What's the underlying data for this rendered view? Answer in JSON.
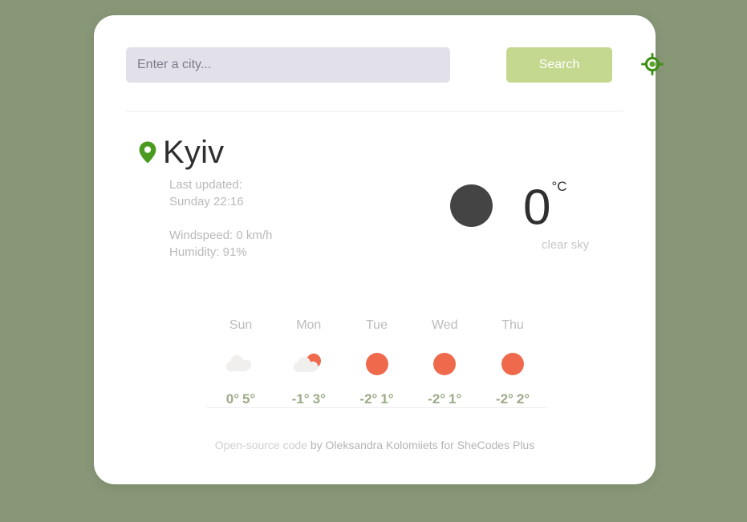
{
  "theme": {
    "page_background": "#889877",
    "card_background": "#ffffff",
    "accent_green": "#c5d890",
    "icon_green": "#4a9a20",
    "sun_orange": "#ef6a4c",
    "cloud_gray": "#f0efed",
    "forecast_temp_color": "#9cab88",
    "night_circle": "#444444"
  },
  "search": {
    "placeholder": "Enter a city...",
    "value": "",
    "button_label": "Search",
    "geolocation_icon": "gps-target-icon"
  },
  "current": {
    "location_icon": "map-pin-icon",
    "city": "Kyiv",
    "last_updated_label": "Last updated:",
    "last_updated_value": "Sunday 22:16",
    "windspeed": "Windspeed: 0 km/h",
    "humidity": "Humidity: 91%",
    "icon": "clear-sky-night-icon",
    "temperature": "0",
    "unit": "°C",
    "description": "clear sky"
  },
  "forecast": [
    {
      "day": "Sun",
      "icon": "cloud-icon",
      "temp_max": "0°",
      "temp_min": "5°"
    },
    {
      "day": "Mon",
      "icon": "sun-behind-cloud-icon",
      "temp_max": "-1°",
      "temp_min": "3°"
    },
    {
      "day": "Tue",
      "icon": "sun-icon",
      "temp_max": "-2°",
      "temp_min": "1°"
    },
    {
      "day": "Wed",
      "icon": "sun-icon",
      "temp_max": "-2°",
      "temp_min": "1°"
    },
    {
      "day": "Thu",
      "icon": "sun-icon",
      "temp_max": "-2°",
      "temp_min": "2°"
    }
  ],
  "footer": {
    "link_text": "Open-source code",
    "rest_text": " by Oleksandra Kolomiiets for SheCodes Plus"
  }
}
